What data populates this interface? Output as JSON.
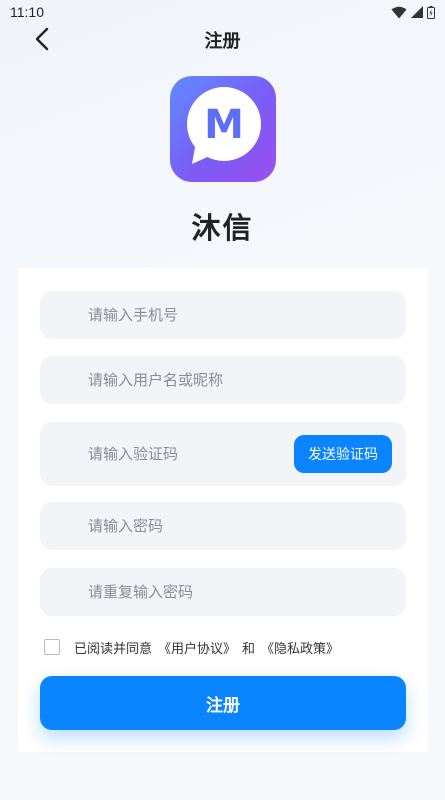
{
  "status_bar": {
    "time": "11:10",
    "icons": [
      "wifi-icon",
      "signal-icon",
      "battery-icon"
    ]
  },
  "nav": {
    "title": "注册",
    "back_icon": "chevron-left-icon"
  },
  "app": {
    "logo_letter": "M",
    "name": "沐信"
  },
  "form": {
    "phone_placeholder": "请输入手机号",
    "username_placeholder": "请输入用户名或昵称",
    "code_placeholder": "请输入验证码",
    "send_code_label": "发送验证码",
    "password_placeholder": "请输入密码",
    "confirm_password_placeholder": "请重复输入密码",
    "agreement": {
      "prefix": "已阅读并同意",
      "user_agreement": "《用户协议》",
      "conjunction": "和",
      "privacy_policy": "《隐私政策》",
      "checked": false
    },
    "register_label": "注册"
  },
  "colors": {
    "primary": "#0a84ff",
    "logo_gradient_start": "#5f8cff",
    "logo_gradient_end": "#9a4ff0",
    "input_background": "#f3f4f7"
  }
}
